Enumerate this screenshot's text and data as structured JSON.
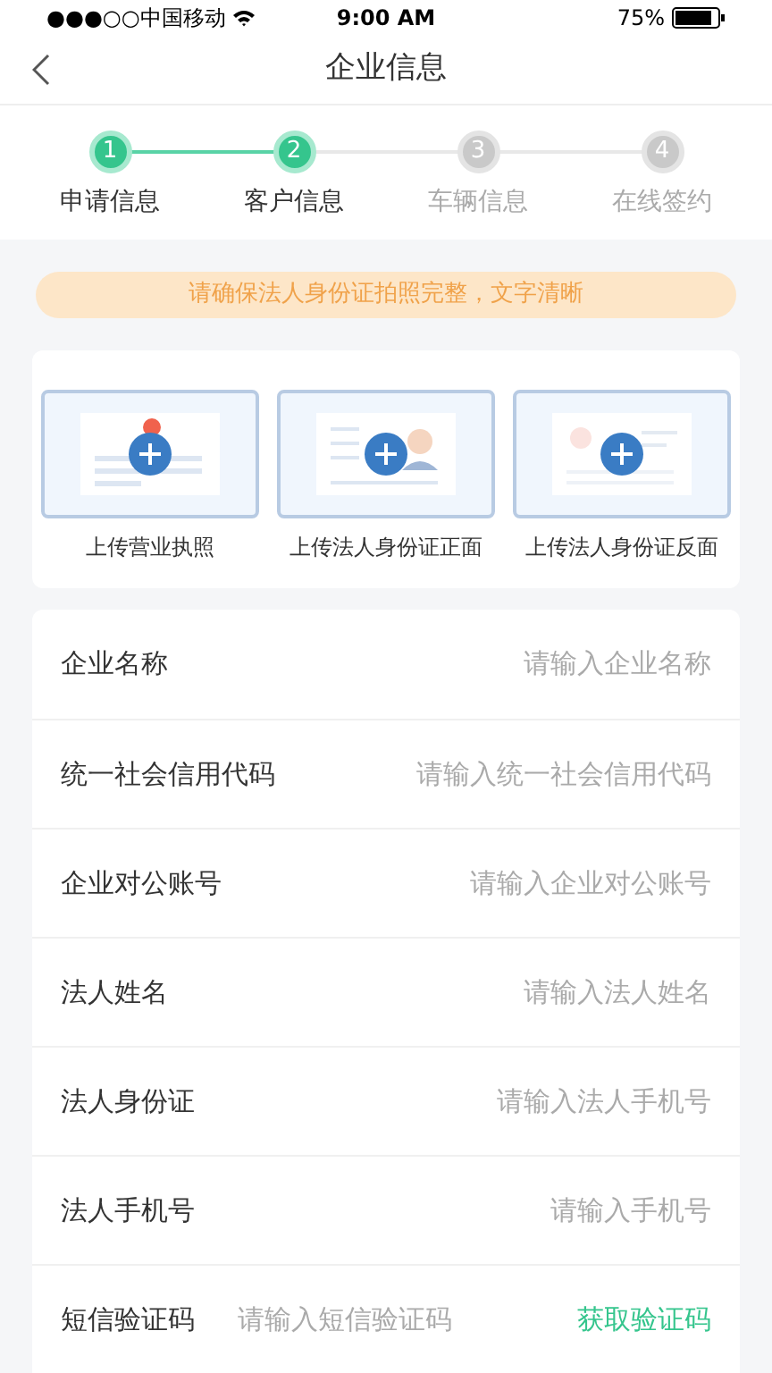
{
  "status_bar": {
    "carrier": "●●●○○中国移动",
    "time": "9:00 AM",
    "battery": "75%"
  },
  "nav": {
    "title": "企业信息"
  },
  "steps": [
    {
      "number": "1",
      "label": "申请信息",
      "done": true
    },
    {
      "number": "2",
      "label": "客户信息",
      "done": true
    },
    {
      "number": "3",
      "label": "车辆信息",
      "done": false
    },
    {
      "number": "4",
      "label": "在线签约",
      "done": false
    }
  ],
  "notice": "请确保法人身份证拍照完整，文字清晰",
  "uploads": [
    {
      "kind": "license",
      "label": "上传营业执照"
    },
    {
      "kind": "id_front",
      "label": "上传法人身份证正面"
    },
    {
      "kind": "id_back",
      "label": "上传法人身份证反面"
    }
  ],
  "fields": [
    {
      "label": "企业名称",
      "placeholder": "请输入企业名称"
    },
    {
      "label": "统一社会信用代码",
      "placeholder": "请输入统一社会信用代码"
    },
    {
      "label": "企业对公账号",
      "placeholder": "请输入企业对公账号"
    },
    {
      "label": "法人姓名",
      "placeholder": "请输入法人姓名"
    },
    {
      "label": "法人身份证",
      "placeholder": "请输入法人手机号"
    },
    {
      "label": "法人手机号",
      "placeholder": "请输入手机号"
    },
    {
      "label": "短信验证码",
      "placeholder": "请输入短信验证码",
      "action": "获取验证码"
    }
  ]
}
